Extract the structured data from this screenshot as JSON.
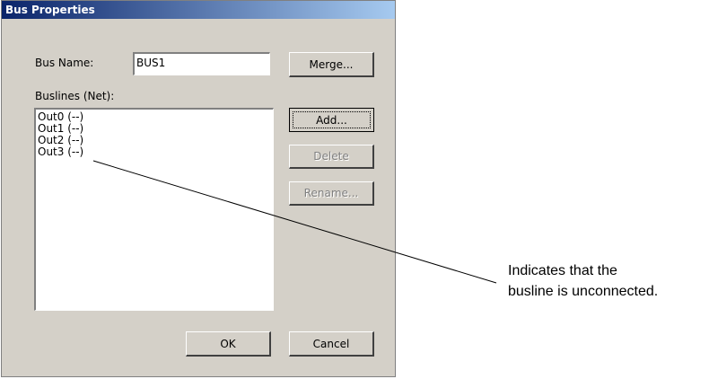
{
  "window": {
    "title": "Bus Properties"
  },
  "bus_name": {
    "label": "Bus Name:",
    "value": "BUS1"
  },
  "buslines": {
    "label": "Buslines (Net):",
    "items": [
      "Out0 (--)",
      "Out1 (--)",
      "Out2 (--)",
      "Out3 (--)"
    ]
  },
  "buttons": {
    "merge": "Merge...",
    "add": "Add...",
    "delete": "Delete",
    "rename": "Rename...",
    "ok": "OK",
    "cancel": "Cancel"
  },
  "annotation": {
    "line1": "Indicates that the",
    "line2": "busline is unconnected."
  }
}
